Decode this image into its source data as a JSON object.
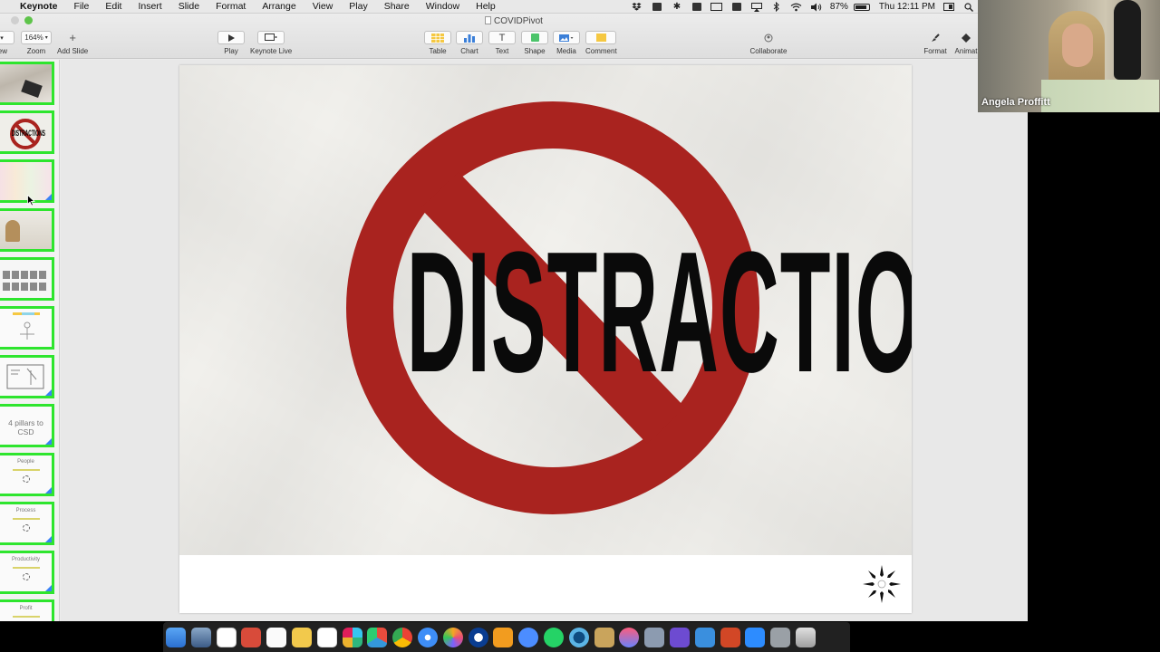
{
  "menubar": {
    "app": "Keynote",
    "items": [
      "File",
      "Edit",
      "Insert",
      "Slide",
      "Format",
      "Arrange",
      "View",
      "Play",
      "Share",
      "Window",
      "Help"
    ],
    "battery": "87%",
    "clock": "Thu 12:11 PM"
  },
  "document": {
    "title": "COVIDPivot"
  },
  "toolbar": {
    "view_label": "iew",
    "zoom_value": "164%",
    "zoom_label": "Zoom",
    "add_slide_label": "Add Slide",
    "play_label": "Play",
    "keynote_live_label": "Keynote Live",
    "table_label": "Table",
    "chart_label": "Chart",
    "text_label": "Text",
    "shape_label": "Shape",
    "media_label": "Media",
    "comment_label": "Comment",
    "collaborate_label": "Collaborate",
    "format_label": "Format",
    "animate_label": "Animat"
  },
  "slides": [
    {
      "kind": "photo"
    },
    {
      "kind": "distractions",
      "text": "DISTRACTIONS",
      "selected": true
    },
    {
      "kind": "pastel"
    },
    {
      "kind": "photo-person"
    },
    {
      "kind": "grid"
    },
    {
      "kind": "sketch"
    },
    {
      "kind": "diagram"
    },
    {
      "kind": "text",
      "text": "4 pillars to CSD"
    },
    {
      "kind": "pillar",
      "title": "People"
    },
    {
      "kind": "pillar",
      "title": "Process"
    },
    {
      "kind": "pillar",
      "title": "Productivity"
    },
    {
      "kind": "pillar",
      "title": "Profit"
    }
  ],
  "slide": {
    "title": "DISTRACTIONS",
    "sign_color": "#a9231f",
    "text_color": "#0a0a0a"
  },
  "webcam": {
    "name": "Angela Proffitt"
  },
  "colors": {
    "thumb_border": "#2ee52e",
    "selection": "#3a7bf0"
  }
}
